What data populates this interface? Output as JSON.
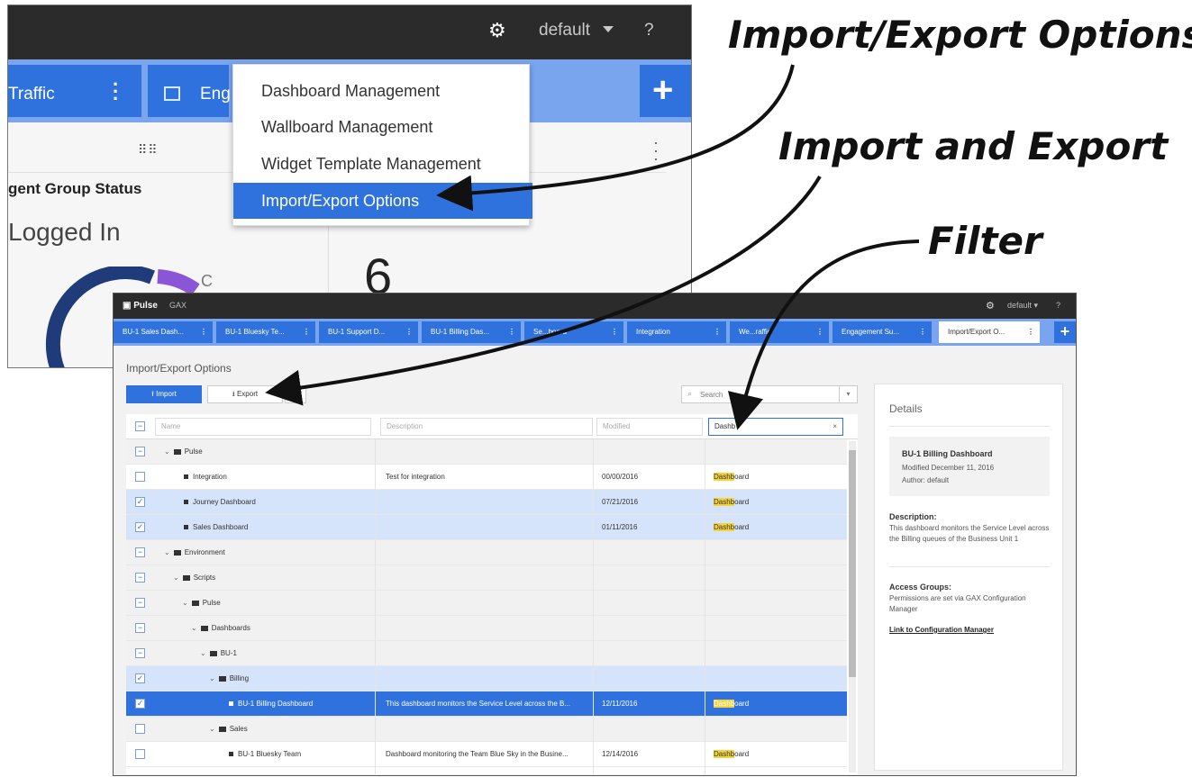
{
  "back": {
    "username": "default",
    "help": "?",
    "tabs": [
      {
        "label": "Traffic"
      },
      {
        "label": "Eng"
      }
    ],
    "plus": "+",
    "widget_title": "gent Group Status",
    "metric_label": "Logged In",
    "metric_value": "6",
    "donut_label": "C",
    "menu": {
      "items": [
        "Dashboard Management",
        "Wallboard Management",
        "Widget Template Management",
        "Import/Export Options"
      ],
      "selected_index": 3
    }
  },
  "annotations": {
    "import_export_options": "Import/Export Options",
    "import_and_export": "Import and Export",
    "filter": "Filter"
  },
  "front": {
    "brand": "Pulse",
    "brand_sub": "GAX",
    "username": "default",
    "help": "?",
    "tabs": [
      "BU-1 Sales Dash...",
      "BU-1 Bluesky Te...",
      "BU-1 Support D...",
      "BU-1 Billing Das...",
      "Se...board",
      "Integration",
      "We...raffic",
      "Engagement Su...",
      "Import/Export O..."
    ],
    "active_tab_index": 8,
    "page_title": "Import/Export Options",
    "import_label": "Import",
    "export_label": "Export",
    "search_placeholder": "Search",
    "columns": {
      "name": "Name",
      "description": "Description",
      "modified": "Modified",
      "filter_value": "Dashb"
    },
    "rows": [
      {
        "name": "Pulse",
        "type": "folder",
        "depth": 0,
        "expanded": true,
        "checked": "partial",
        "desc": "",
        "modified": "",
        "match": ""
      },
      {
        "name": "Integration",
        "type": "item",
        "depth": 1,
        "checked": "none",
        "desc": "Test for integration",
        "modified": "00/00/2016",
        "match": "Dashboard"
      },
      {
        "name": "Journey Dashboard",
        "type": "item",
        "depth": 1,
        "checked": "checked",
        "desc": "",
        "modified": "07/21/2016",
        "match": "Dashboard"
      },
      {
        "name": "Sales Dashboard",
        "type": "item",
        "depth": 1,
        "checked": "checked",
        "desc": "",
        "modified": "01/11/2016",
        "match": "Dashboard"
      },
      {
        "name": "Environment",
        "type": "folder",
        "depth": 0,
        "expanded": true,
        "checked": "partial",
        "desc": "",
        "modified": "",
        "match": ""
      },
      {
        "name": "Scripts",
        "type": "folder",
        "depth": 1,
        "expanded": true,
        "checked": "partial",
        "desc": "",
        "modified": "",
        "match": ""
      },
      {
        "name": "Pulse",
        "type": "folder",
        "depth": 2,
        "expanded": true,
        "checked": "partial",
        "desc": "",
        "modified": "",
        "match": ""
      },
      {
        "name": "Dashboards",
        "type": "folder",
        "depth": 3,
        "expanded": true,
        "checked": "partial",
        "desc": "",
        "modified": "",
        "match": ""
      },
      {
        "name": "BU-1",
        "type": "folder",
        "depth": 4,
        "expanded": true,
        "checked": "partial",
        "desc": "",
        "modified": "",
        "match": ""
      },
      {
        "name": "Billing",
        "type": "folder",
        "depth": 5,
        "expanded": true,
        "checked": "checked",
        "desc": "",
        "modified": "",
        "match": ""
      },
      {
        "name": "BU-1 Billing Dashboard",
        "type": "item",
        "depth": 6,
        "checked": "checked",
        "desc": "This dashboard monitors the Service Level across the B...",
        "modified": "12/11/2016",
        "match": "Dashboard",
        "highlight": true
      },
      {
        "name": "Sales",
        "type": "folder",
        "depth": 5,
        "expanded": true,
        "checked": "none",
        "desc": "",
        "modified": "",
        "match": ""
      },
      {
        "name": "BU-1 Bluesky Team",
        "type": "item",
        "depth": 6,
        "checked": "none",
        "desc": "Dashboard monitoring the Team Blue Sky in the Busine...",
        "modified": "12/14/2016",
        "match": "Dashboard"
      }
    ],
    "details": {
      "heading": "Details",
      "title": "BU-1 Billing Dashboard",
      "modified": "Modified December 11, 2016",
      "author": "Author: default",
      "desc_label": "Description:",
      "desc_text": "This dashboard monitors the Service Level across the Billing queues of the Business Unit 1",
      "access_label": "Access Groups:",
      "access_text": "Permissions are set via GAX Configuration Manager",
      "link": "Link to Configuration Manager"
    },
    "colors": {
      "accent": "#2f72de",
      "tab_strip": "#79a5ef",
      "top_bar": "#2b2b2b",
      "selection": "#d5e3fb",
      "match_highlight": "#f5d33a"
    }
  }
}
